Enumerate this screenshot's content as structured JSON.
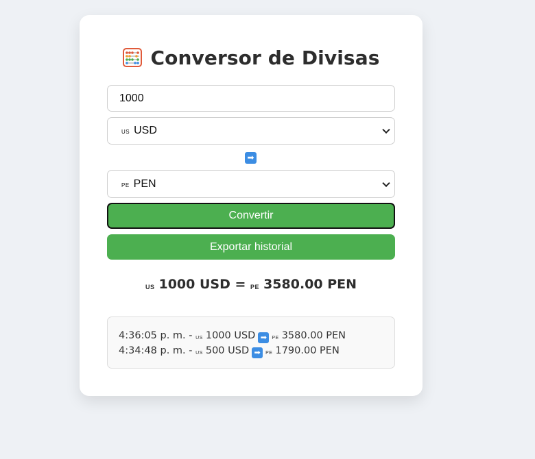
{
  "title": "Conversor de Divisas",
  "title_icon": "abacus-icon",
  "amount": {
    "value": "1000"
  },
  "from_currency": {
    "flag": "us",
    "code": "USD"
  },
  "arrow_icon": "right-arrow-emoji",
  "arrow_glyph": "➡",
  "to_currency": {
    "flag": "pe",
    "code": "PEN"
  },
  "buttons": {
    "convert": "Convertir",
    "export": "Exportar historial"
  },
  "result": {
    "from_flag": "us",
    "from_text": "1000 USD",
    "equals": "=",
    "to_flag": "pe",
    "to_text": "3580.00 PEN"
  },
  "history": [
    {
      "time": "4:36:05 p. m.",
      "sep": "-",
      "from_flag": "us",
      "from": "1000 USD",
      "to_flag": "pe",
      "to": "3580.00 PEN"
    },
    {
      "time": "4:34:48 p. m.",
      "sep": "-",
      "from_flag": "us",
      "from": "500 USD",
      "to_flag": "pe",
      "to": "1790.00 PEN"
    }
  ],
  "colors": {
    "background": "#eef1f5",
    "button_green": "#4caf50",
    "arrow_blue": "#3c8de3"
  }
}
